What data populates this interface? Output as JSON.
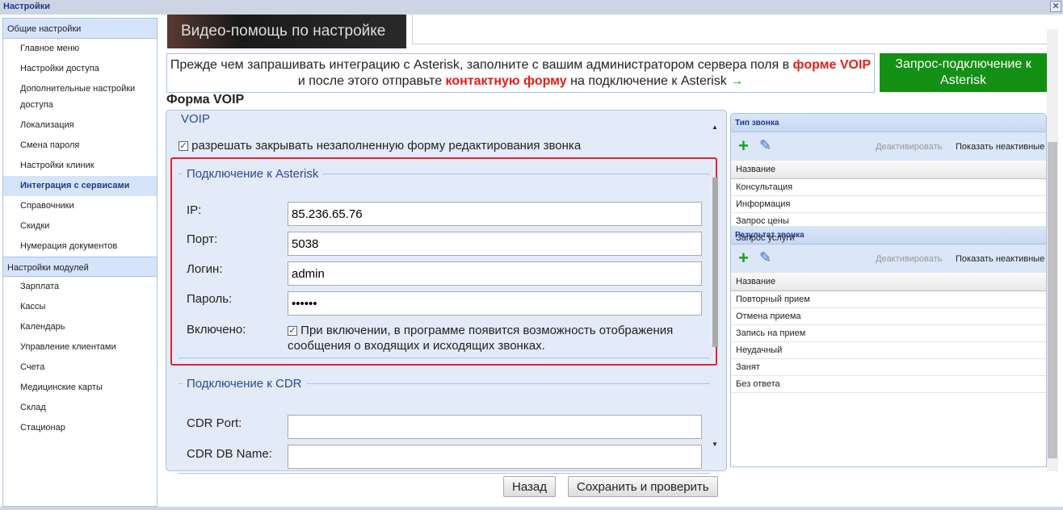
{
  "window": {
    "title": "Настройки",
    "close": "✕"
  },
  "sidebar": {
    "general_header": "Общие настройки",
    "general_items": [
      "Главное меню",
      "Настройки доступа",
      "Дополнительные настройки доступа",
      "Локализация",
      "Смена пароля",
      "Настройки клиник",
      "Интеграция с сервисами",
      "Справочники",
      "Скидки",
      "Нумерация документов"
    ],
    "active": "Интеграция с сервисами",
    "modules_header": "Настройки модулей",
    "module_items": [
      "Зарплата",
      "Кассы",
      "Календарь",
      "Управление клиентами",
      "Счета",
      "Медицинские карты",
      "Склад",
      "Стационар"
    ]
  },
  "video": {
    "caption": "Видео-помощь по настройке"
  },
  "info": {
    "t1": "Прежде чем запрашивать интеграцию с Asterisk, заполните с вашим администратором сервера поля в ",
    "l1": "форме VOIP",
    "t2": " и после этого отправьте ",
    "l2": "контактную форму",
    "t3": " на подключение к Asterisk ",
    "arrow": "→"
  },
  "request_button": "Запрос-подключение к Asterisk",
  "form_title": "Форма VOIP",
  "voip": {
    "legend": "VOIP",
    "allow_close": {
      "label": "разрешать закрывать незаполненную форму редактирования звонка",
      "checked": true
    },
    "asterisk": {
      "legend": "Подключение к Asterisk",
      "ip_label": "IP:",
      "ip": "85.236.65.76",
      "port_label": "Порт:",
      "port": "5038",
      "login_label": "Логин:",
      "login": "admin",
      "password_label": "Пароль:",
      "password": "••••••",
      "enabled_label": "Включено:",
      "enabled": true,
      "enabled_text": "При включении, в программе появится возможность отображения сообщения о входящих и исходящих звонках."
    },
    "cdr": {
      "legend": "Подключение к CDR",
      "port_label": "CDR Port:",
      "port": "",
      "db_label": "CDR DB Name:",
      "db": ""
    }
  },
  "call_type": {
    "title": "Тип звонка",
    "deactivate": "Деактивировать",
    "show_inactive": "Показать неактивные",
    "column": "Название",
    "rows": [
      "Консультация",
      "Информация",
      "Запрос цены",
      "Запрос услуги"
    ]
  },
  "call_result": {
    "title": "Результат звонка",
    "deactivate": "Деактивировать",
    "show_inactive": "Показать неактивные",
    "column": "Название",
    "rows": [
      "Повторный прием",
      "Отмена приема",
      "Запись на прием",
      "Неудачный",
      "Занят",
      "Без ответа"
    ]
  },
  "buttons": {
    "back": "Назад",
    "save": "Сохранить и проверить"
  }
}
